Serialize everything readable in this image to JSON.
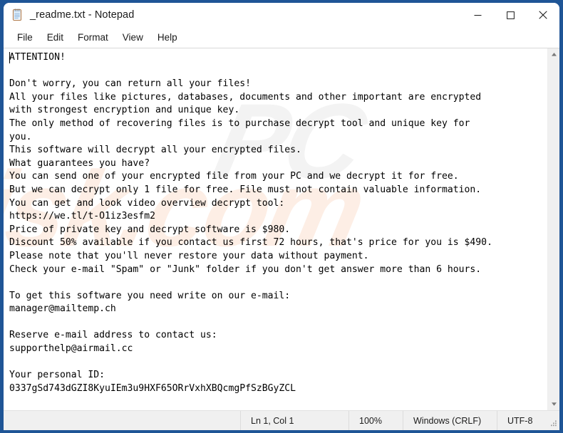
{
  "window": {
    "title": "_readme.txt - Notepad",
    "icon": "notepad-icon",
    "controls": {
      "minimize": "minimize-icon",
      "maximize": "maximize-icon",
      "close": "close-icon"
    }
  },
  "menu": {
    "items": [
      {
        "label": "File"
      },
      {
        "label": "Edit"
      },
      {
        "label": "Format"
      },
      {
        "label": "View"
      },
      {
        "label": "Help"
      }
    ]
  },
  "editor": {
    "watermark_front": "isk.com",
    "watermark_back": "PC",
    "text": "ATTENTION!\n\nDon't worry, you can return all your files!\nAll your files like pictures, databases, documents and other important are encrypted\nwith strongest encryption and unique key.\nThe only method of recovering files is to purchase decrypt tool and unique key for\nyou.\nThis software will decrypt all your encrypted files.\nWhat guarantees you have?\nYou can send one of your encrypted file from your PC and we decrypt it for free.\nBut we can decrypt only 1 file for free. File must not contain valuable information.\nYou can get and look video overview decrypt tool:\nhttps://we.tl/t-O1iz3esfm2\nPrice of private key and decrypt software is $980.\nDiscount 50% available if you contact us first 72 hours, that's price for you is $490.\nPlease note that you'll never restore your data without payment.\nCheck your e-mail \"Spam\" or \"Junk\" folder if you don't get answer more than 6 hours.\n\nTo get this software you need write on our e-mail:\nmanager@mailtemp.ch\n\nReserve e-mail address to contact us:\nsupporthelp@airmail.cc\n\nYour personal ID:\n0337gSd743dGZI8KyuIEm3u9HXF65ORrVxhXBQcmgPfSzBGyZCL"
  },
  "scrollbar": {
    "up_arrow": "scroll-up-icon",
    "down_arrow": "scroll-down-icon"
  },
  "status_bar": {
    "cursor_position": "Ln 1, Col 1",
    "zoom_level": "100%",
    "line_ending": "Windows (CRLF)",
    "encoding": "UTF-8",
    "resize_grip": "resize-grip-icon"
  },
  "colors": {
    "window_border": "#1f5596",
    "status_background": "#f0f0f0",
    "text": "#000000",
    "watermark_front": "#fdeee5",
    "watermark_back": "#f3f3f3"
  }
}
